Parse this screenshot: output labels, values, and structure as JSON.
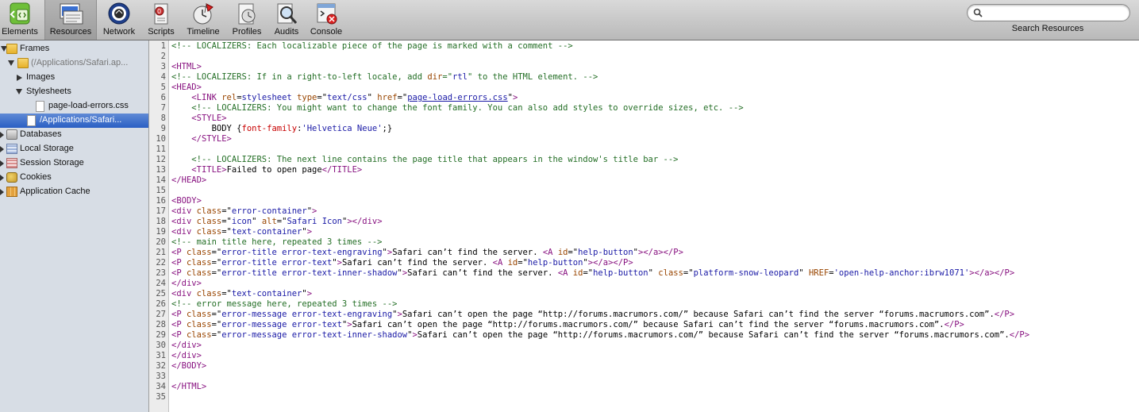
{
  "toolbar": {
    "buttons": [
      {
        "label": "Elements",
        "icon": "elements-icon"
      },
      {
        "label": "Resources",
        "icon": "resources-icon"
      },
      {
        "label": "Network",
        "icon": "network-icon"
      },
      {
        "label": "Scripts",
        "icon": "scripts-icon"
      },
      {
        "label": "Timeline",
        "icon": "timeline-icon"
      },
      {
        "label": "Profiles",
        "icon": "profiles-icon"
      },
      {
        "label": "Audits",
        "icon": "audits-icon"
      },
      {
        "label": "Console",
        "icon": "console-icon"
      }
    ],
    "selected": "Resources",
    "search": {
      "placeholder": "",
      "value": "",
      "caption": "Search Resources"
    }
  },
  "sidebar": {
    "items": [
      {
        "label": "Frames",
        "expanded": true,
        "icon": "folder-icon"
      },
      {
        "label": "(/Applications/Safari.ap...",
        "expanded": true,
        "icon": "folder-icon"
      },
      {
        "label": "Images",
        "expanded": false
      },
      {
        "label": "Stylesheets",
        "expanded": true
      },
      {
        "label": "page-load-errors.css",
        "icon": "document-icon"
      },
      {
        "label": "/Applications/Safari...",
        "icon": "document-icon",
        "selected": true
      },
      {
        "label": "Databases",
        "icon": "database-icon"
      },
      {
        "label": "Local Storage",
        "icon": "local-storage-icon"
      },
      {
        "label": "Session Storage",
        "icon": "session-storage-icon"
      },
      {
        "label": "Cookies",
        "icon": "cookie-icon"
      },
      {
        "label": "Application Cache",
        "icon": "application-cache-icon"
      }
    ]
  },
  "source": {
    "line_numbers": [
      "1",
      "2",
      "3",
      "4",
      "5",
      "6",
      "7",
      "8",
      "9",
      "10",
      "11",
      "12",
      "13",
      "14",
      "15",
      "16",
      "17",
      "18",
      "19",
      "20",
      "21",
      "22",
      "23",
      "24",
      "25",
      "26",
      "27",
      "28",
      "29",
      "30",
      "31",
      "32",
      "33",
      "34",
      "35"
    ],
    "lines": [
      [
        [
          "c",
          "<!-- LOCALIZERS: Each localizable piece of the page is marked with a comment -->"
        ]
      ],
      [],
      [
        [
          "t",
          "<HTML>"
        ]
      ],
      [
        [
          "c",
          "<!-- LOCALIZERS: If in a right-to-left locale, add "
        ],
        [
          "a",
          "dir"
        ],
        [
          "c",
          "=\""
        ],
        [
          "v",
          "rtl"
        ],
        [
          "c",
          "\" to the HTML element. -->"
        ]
      ],
      [
        [
          "t",
          "<HEAD>"
        ]
      ],
      [
        [
          "x",
          "    "
        ],
        [
          "t",
          "<LINK "
        ],
        [
          "a",
          "rel"
        ],
        [
          "x",
          "="
        ],
        [
          "v",
          "stylesheet"
        ],
        [
          "x",
          " "
        ],
        [
          "a",
          "type"
        ],
        [
          "x",
          "=\""
        ],
        [
          "v",
          "text/css"
        ],
        [
          "x",
          "\" "
        ],
        [
          "a",
          "href"
        ],
        [
          "x",
          "=\""
        ],
        [
          "l",
          "page-load-errors.css"
        ],
        [
          "x",
          "\""
        ],
        [
          "t",
          ">"
        ]
      ],
      [
        [
          "x",
          "    "
        ],
        [
          "c",
          "<!-- LOCALIZERS: You might want to change the font family. You can also add styles to override sizes, etc. -->"
        ]
      ],
      [
        [
          "x",
          "    "
        ],
        [
          "t",
          "<STYLE>"
        ]
      ],
      [
        [
          "x",
          "        BODY {"
        ],
        [
          "p",
          "font-family"
        ],
        [
          "x",
          ":"
        ],
        [
          "v",
          "'Helvetica Neue'"
        ],
        [
          "x",
          ";}"
        ]
      ],
      [
        [
          "x",
          "    "
        ],
        [
          "t",
          "</STYLE>"
        ]
      ],
      [],
      [
        [
          "x",
          "    "
        ],
        [
          "c",
          "<!-- LOCALIZERS: The next line contains the page title that appears in the window's title bar -->"
        ]
      ],
      [
        [
          "x",
          "    "
        ],
        [
          "t",
          "<TITLE>"
        ],
        [
          "x",
          "Failed to open page"
        ],
        [
          "t",
          "</TITLE>"
        ]
      ],
      [
        [
          "t",
          "</HEAD>"
        ]
      ],
      [],
      [
        [
          "t",
          "<BODY>"
        ]
      ],
      [
        [
          "t",
          "<div "
        ],
        [
          "a",
          "class"
        ],
        [
          "x",
          "=\""
        ],
        [
          "v",
          "error-container"
        ],
        [
          "x",
          "\""
        ],
        [
          "t",
          ">"
        ]
      ],
      [
        [
          "t",
          "<div "
        ],
        [
          "a",
          "class"
        ],
        [
          "x",
          "=\""
        ],
        [
          "v",
          "icon"
        ],
        [
          "x",
          "\" "
        ],
        [
          "a",
          "alt"
        ],
        [
          "x",
          "=\""
        ],
        [
          "v",
          "Safari Icon"
        ],
        [
          "x",
          "\""
        ],
        [
          "t",
          "></div>"
        ]
      ],
      [
        [
          "t",
          "<div "
        ],
        [
          "a",
          "class"
        ],
        [
          "x",
          "=\""
        ],
        [
          "v",
          "text-container"
        ],
        [
          "x",
          "\""
        ],
        [
          "t",
          ">"
        ]
      ],
      [
        [
          "c",
          "<!-- main title here, repeated 3 times -->"
        ]
      ],
      [
        [
          "t",
          "<P "
        ],
        [
          "a",
          "class"
        ],
        [
          "x",
          "=\""
        ],
        [
          "v",
          "error-title error-text-engraving"
        ],
        [
          "x",
          "\""
        ],
        [
          "t",
          ">"
        ],
        [
          "x",
          "Safari can’t find the server. "
        ],
        [
          "t",
          "<A "
        ],
        [
          "a",
          "id"
        ],
        [
          "x",
          "=\""
        ],
        [
          "v",
          "help-button"
        ],
        [
          "x",
          "\""
        ],
        [
          "t",
          "></a></P>"
        ]
      ],
      [
        [
          "t",
          "<P "
        ],
        [
          "a",
          "class"
        ],
        [
          "x",
          "=\""
        ],
        [
          "v",
          "error-title error-text"
        ],
        [
          "x",
          "\""
        ],
        [
          "t",
          ">"
        ],
        [
          "x",
          "Safari can’t find the server. "
        ],
        [
          "t",
          "<A "
        ],
        [
          "a",
          "id"
        ],
        [
          "x",
          "=\""
        ],
        [
          "v",
          "help-button"
        ],
        [
          "x",
          "\""
        ],
        [
          "t",
          "></a></P>"
        ]
      ],
      [
        [
          "t",
          "<P "
        ],
        [
          "a",
          "class"
        ],
        [
          "x",
          "=\""
        ],
        [
          "v",
          "error-title error-text-inner-shadow"
        ],
        [
          "x",
          "\""
        ],
        [
          "t",
          ">"
        ],
        [
          "x",
          "Safari can’t find the server. "
        ],
        [
          "t",
          "<A "
        ],
        [
          "a",
          "id"
        ],
        [
          "x",
          "=\""
        ],
        [
          "v",
          "help-button"
        ],
        [
          "x",
          "\" "
        ],
        [
          "a",
          "class"
        ],
        [
          "x",
          "=\""
        ],
        [
          "v",
          "platform-snow-leopard"
        ],
        [
          "x",
          "\" "
        ],
        [
          "a",
          "HREF"
        ],
        [
          "x",
          "="
        ],
        [
          "v",
          "'open-help-anchor:ibrw1071'"
        ],
        [
          "t",
          "></a></P>"
        ]
      ],
      [
        [
          "t",
          "</div>"
        ]
      ],
      [
        [
          "t",
          "<div "
        ],
        [
          "a",
          "class"
        ],
        [
          "x",
          "=\""
        ],
        [
          "v",
          "text-container"
        ],
        [
          "x",
          "\""
        ],
        [
          "t",
          ">"
        ]
      ],
      [
        [
          "c",
          "<!-- error message here, repeated 3 times -->"
        ]
      ],
      [
        [
          "t",
          "<P "
        ],
        [
          "a",
          "class"
        ],
        [
          "x",
          "=\""
        ],
        [
          "v",
          "error-message error-text-engraving"
        ],
        [
          "x",
          "\""
        ],
        [
          "t",
          ">"
        ],
        [
          "x",
          "Safari can’t open the page “http://forums.macrumors.com/” because Safari can’t find the server “forums.macrumors.com”."
        ],
        [
          "t",
          "</P>"
        ]
      ],
      [
        [
          "t",
          "<P "
        ],
        [
          "a",
          "class"
        ],
        [
          "x",
          "=\""
        ],
        [
          "v",
          "error-message error-text"
        ],
        [
          "x",
          "\""
        ],
        [
          "t",
          ">"
        ],
        [
          "x",
          "Safari can’t open the page “http://forums.macrumors.com/” because Safari can’t find the server “forums.macrumors.com”."
        ],
        [
          "t",
          "</P>"
        ]
      ],
      [
        [
          "t",
          "<P "
        ],
        [
          "a",
          "class"
        ],
        [
          "x",
          "=\""
        ],
        [
          "v",
          "error-message error-text-inner-shadow"
        ],
        [
          "x",
          "\""
        ],
        [
          "t",
          ">"
        ],
        [
          "x",
          "Safari can’t open the page “http://forums.macrumors.com/” because Safari can’t find the server “forums.macrumors.com”."
        ],
        [
          "t",
          "</P>"
        ]
      ],
      [
        [
          "t",
          "</div>"
        ]
      ],
      [
        [
          "t",
          "</div>"
        ]
      ],
      [
        [
          "t",
          "</BODY>"
        ]
      ],
      [],
      [
        [
          "t",
          "</HTML>"
        ]
      ],
      []
    ]
  }
}
